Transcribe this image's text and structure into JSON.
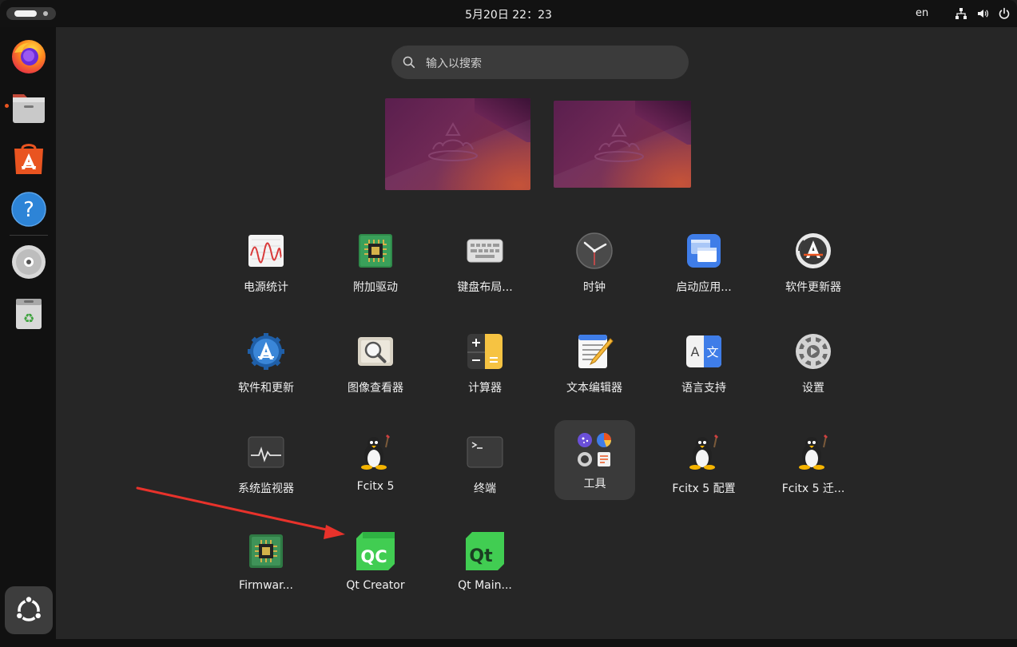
{
  "topbar": {
    "clock": "5月20日  22：23",
    "keyboard_layout": "en"
  },
  "dock": {
    "items": [
      {
        "name": "Firefox",
        "icon": "firefox-icon"
      },
      {
        "name": "Files",
        "icon": "files-icon"
      },
      {
        "name": "App Center",
        "icon": "app-center-icon"
      },
      {
        "name": "Help",
        "icon": "help-icon"
      },
      {
        "name": "Disc",
        "icon": "disc-icon"
      },
      {
        "name": "Trash",
        "icon": "trash-icon"
      }
    ],
    "show_apps": "ubuntu-logo-icon"
  },
  "search": {
    "placeholder": "输入以搜索"
  },
  "apps": [
    {
      "label": "电源统计",
      "icon": "power-statistics-icon"
    },
    {
      "label": "附加驱动",
      "icon": "additional-drivers-icon"
    },
    {
      "label": "键盘布局...",
      "icon": "keyboard-icon"
    },
    {
      "label": "时钟",
      "icon": "clock-icon"
    },
    {
      "label": "启动应用...",
      "icon": "startup-apps-icon"
    },
    {
      "label": "软件更新器",
      "icon": "software-updater-icon"
    },
    {
      "label": "软件和更新",
      "icon": "software-and-updates-icon"
    },
    {
      "label": "图像查看器",
      "icon": "image-viewer-icon"
    },
    {
      "label": "计算器",
      "icon": "calculator-icon"
    },
    {
      "label": "文本编辑器",
      "icon": "text-editor-icon"
    },
    {
      "label": "语言支持",
      "icon": "language-support-icon"
    },
    {
      "label": "设置",
      "icon": "settings-icon"
    },
    {
      "label": "系统监视器",
      "icon": "system-monitor-icon"
    },
    {
      "label": "Fcitx 5",
      "icon": "tux-icon"
    },
    {
      "label": "终端",
      "icon": "terminal-icon"
    },
    {
      "label": "工具",
      "icon": "folder-icon"
    },
    {
      "label": "Fcitx 5 配置",
      "icon": "tux-icon"
    },
    {
      "label": "Fcitx 5 迁...",
      "icon": "tux-icon"
    },
    {
      "label": "Firmwar...",
      "icon": "firmware-icon"
    },
    {
      "label": "Qt Creator",
      "icon": "qt-creator-icon"
    },
    {
      "label": "Qt Main...",
      "icon": "qt-icon"
    }
  ],
  "colors": {
    "accent": "#e95420",
    "arrow": "#e8322b",
    "qt_green": "#41cd52"
  }
}
